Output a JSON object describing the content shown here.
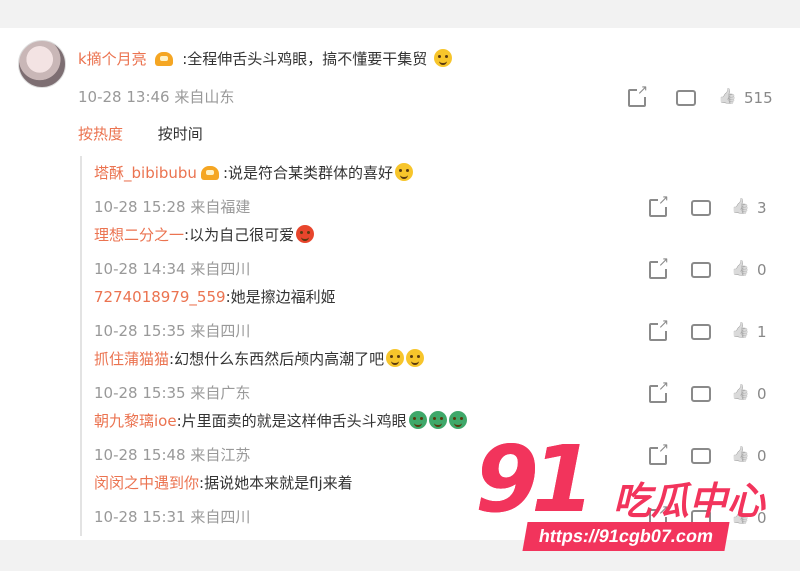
{
  "top_comment": {
    "username": "k摘个月亮",
    "text": ":全程伸舌头斗鸡眼，搞不懂要干集贸",
    "time": "10-28 13:46",
    "location": "来自山东",
    "likes": "515"
  },
  "sort": {
    "hot": "按热度",
    "time": "按时间"
  },
  "replies": [
    {
      "username": "塔酥_bibibubu",
      "text": ":说是符合某类群体的喜好",
      "time": "10-28 15:28",
      "location": "来自福建",
      "likes": "3"
    },
    {
      "username": "理想二分之一",
      "text": ":以为自己很可爱",
      "time": "10-28 14:34",
      "location": "来自四川",
      "likes": "0"
    },
    {
      "username": "7274018979_559",
      "text": ":她是擦边福利姬",
      "time": "10-28 15:35",
      "location": "来自四川",
      "likes": "1"
    },
    {
      "username": "抓住蒲猫猫",
      "text": ":幻想什么东西然后颅内高潮了吧",
      "time": "10-28 15:35",
      "location": "来自广东",
      "likes": "0"
    },
    {
      "username": "朝九黎璃ioe",
      "text": ":片里面卖的就是这样伸舌头斗鸡眼",
      "time": "10-28 15:48",
      "location": "来自江苏",
      "likes": "0"
    },
    {
      "username": "闵闵之中遇到你",
      "text": ":据说她本来就是flj来着",
      "time": "10-28 15:31",
      "location": "来自四川",
      "likes": "0"
    }
  ],
  "watermark": {
    "number": "91",
    "name": "吃瓜中心",
    "url": "https://91cgb07.com"
  }
}
